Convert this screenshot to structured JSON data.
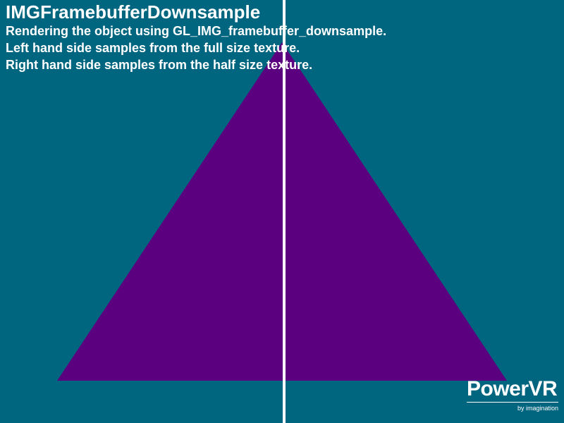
{
  "window": {
    "background": "#00657f"
  },
  "overlay": {
    "title": "IMGFramebufferDownsample",
    "lines": [
      "Rendering the object using GL_IMG_framebuffer_downsample.",
      "Left hand side samples from the full size texture.",
      "Right hand side samples from the half size texture."
    ]
  },
  "scene": {
    "triangle_color": "#5b007f",
    "divider_color": "#ffffff"
  },
  "logo": {
    "brand": "PowerVR",
    "tagline": "by imagination"
  }
}
